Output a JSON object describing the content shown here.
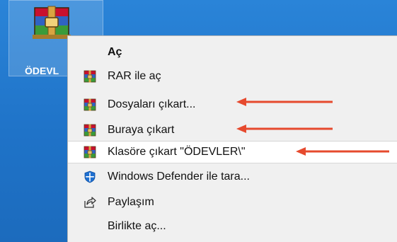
{
  "desktop": {
    "icon_label": "ÖDEVL"
  },
  "context_menu": {
    "items": [
      {
        "label": "Aç",
        "icon": "none"
      },
      {
        "label": "RAR ile aç",
        "icon": "winrar-icon"
      },
      {
        "label": "Dosyaları çıkart...",
        "icon": "winrar-icon"
      },
      {
        "label": "Buraya çıkart",
        "icon": "winrar-icon"
      },
      {
        "label": "Klasöre çıkart \"ÖDEVLER\\\"",
        "icon": "winrar-icon"
      },
      {
        "label": "Windows Defender ile tara...",
        "icon": "windows-defender-icon"
      },
      {
        "label": "Paylaşım",
        "icon": "share-icon"
      },
      {
        "label": "Birlikte aç...",
        "icon": "none"
      }
    ]
  },
  "annotation_colors": {
    "arrow": "#e64a2e",
    "desktop": "#1f73c8"
  }
}
